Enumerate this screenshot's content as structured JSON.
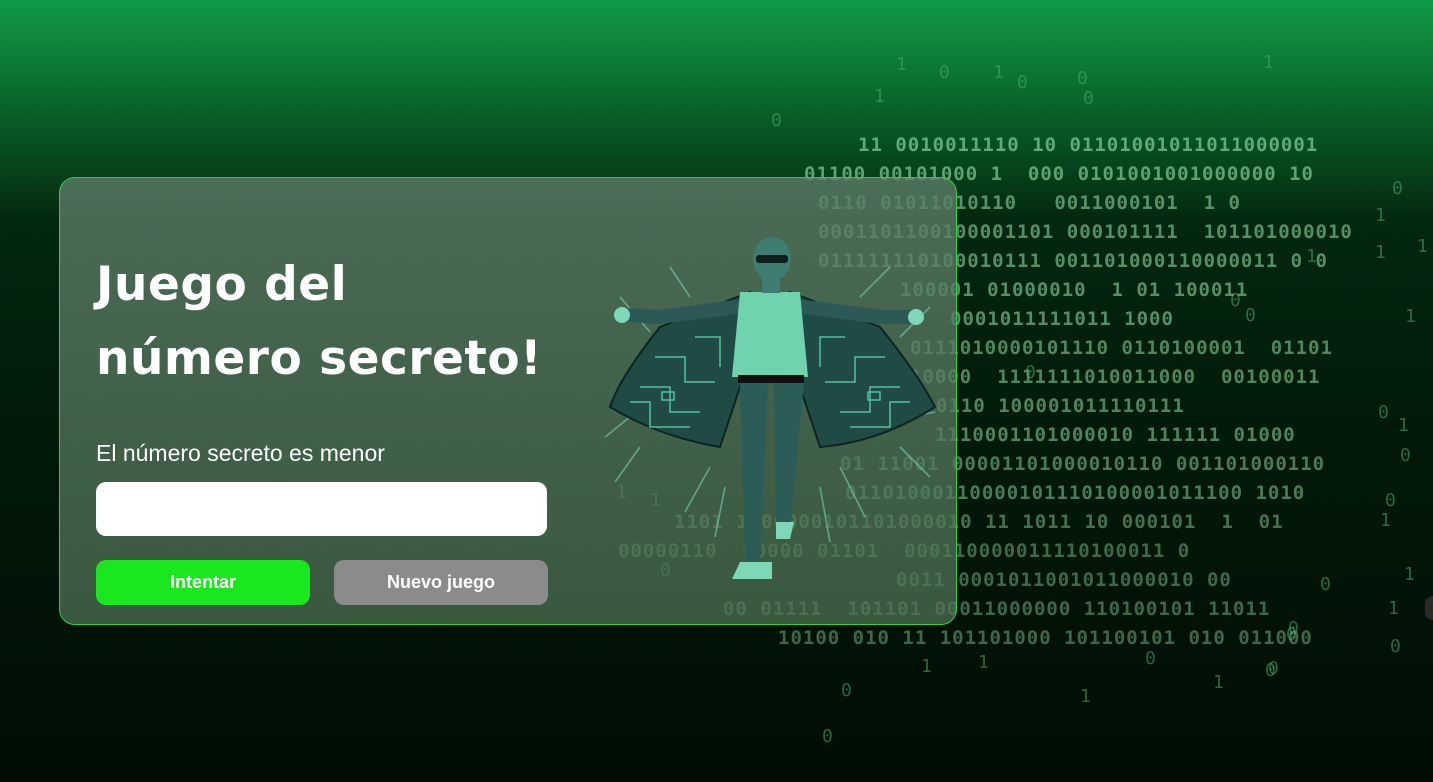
{
  "card": {
    "title_line1": "Juego del",
    "title_line2": "número secreto!",
    "message": "El número secreto es menor",
    "input_value": "",
    "try_label": "Intentar",
    "new_game_label": "Nuevo juego"
  },
  "colors": {
    "border": "#2fd24a",
    "try_button": "#1ae81f",
    "new_game_button": "#8b8b8b"
  },
  "illustration": {
    "icon": "matrix-man-illustration"
  },
  "matrix": {
    "lines": [
      "11 0010011110 10 01101001011011000001",
      "01100 00101000 1  000 0101001001000000 10",
      "0110 01011010110   0011000101  1 0",
      "0001101100100001101 000101111  101101000010",
      "011111110100010111 001101000110000011 0 0",
      "100001 01000010  1 01 100011",
      "0001011111011 1000",
      "0111010000101110 0110100001  01101",
      "10000  1111111010011000  00100011",
      "0110 100001011110111",
      "1110001101000010 111111 01000",
      "01 11001 00001101000010110 001101000110",
      "01101000110000101110100001011100 1010",
      "1101 1100000101101000010 11 1011 10 000101  1  01",
      "00000110  00000 01101  000110000011110100011 0",
      "0011 0001011001011000010 00",
      "00 01111  101101 00011000000 110100101 11011",
      "10100 010 11 101101000 101100101 010 011000"
    ],
    "digits": [
      "1",
      "0",
      "1",
      "0",
      "0",
      "1",
      "0",
      "0",
      "1",
      "0",
      "1",
      "1",
      "1",
      "0",
      "1",
      "0",
      "1",
      "0",
      "0",
      "1",
      "1",
      "0",
      "0",
      "1",
      "0",
      "1",
      "0",
      "0",
      "1",
      "1",
      "0",
      "0",
      "1",
      "0",
      "1",
      "0",
      "0",
      "0",
      "1",
      "1",
      "0"
    ]
  }
}
